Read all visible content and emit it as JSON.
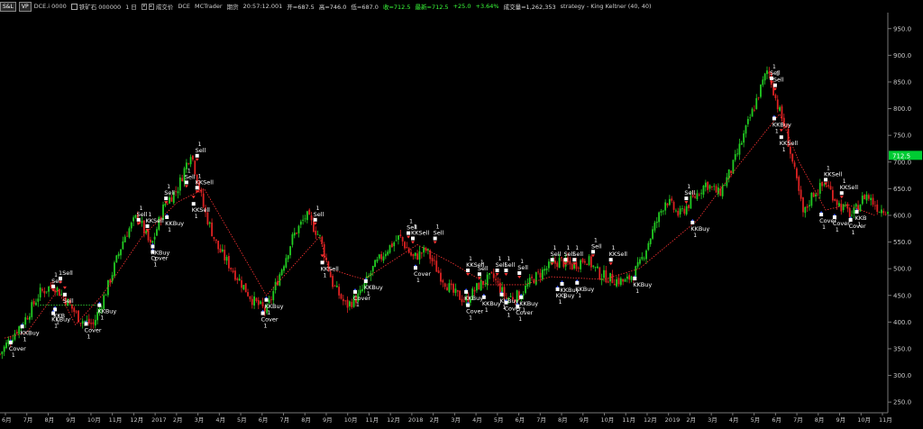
{
  "toolbar": {
    "btn1": "S&L",
    "btn2": "VP",
    "symbol_code": "DCE.i 0000",
    "symbol_name": "铁矿石 000000",
    "period": "1 日",
    "bar_type": "成交价",
    "exchange": "DCE",
    "source": "MCTrader",
    "note": "期货",
    "time": "20:57:12.001",
    "open": "开=687.5",
    "high": "高=746.0",
    "low": "低=687.0",
    "close": "收=712.5",
    "last": "最新=712.5",
    "change": "+25.0",
    "change_pct": "+3.64%",
    "volume": "成交量=1,262,353",
    "strategy": "strategy - King Keltner (40,  40)"
  },
  "colors": {
    "background": "#000000",
    "up_bar": "#22cc22",
    "down_bar": "#dd2222",
    "trade_line": "#ff3333",
    "breakeven_line": "#33cc33",
    "last_price_tag": "#00cc33",
    "axis_text": "#c8c8c8"
  },
  "chart_data": {
    "type": "candlestick",
    "y_axis": {
      "ylim": [
        230,
        980
      ],
      "ticks": [
        250,
        300,
        350,
        400,
        450,
        500,
        550,
        600,
        650,
        700,
        750,
        800,
        850,
        900,
        950
      ],
      "tick_labels": [
        "250.0",
        "300.0",
        "350.0",
        "400.0",
        "450.0",
        "500.0",
        "550.0",
        "600.0",
        "650.0",
        "700.0",
        "750.0",
        "800.0",
        "850.0",
        "900.0",
        "950.0"
      ],
      "last_price_label": "712.5",
      "last_price": 712.5
    },
    "x_axis": {
      "ticks": [
        "6月",
        "7月",
        "8月",
        "9月",
        "10月",
        "11月",
        "12月",
        "2017",
        "2月",
        "3月",
        "4月",
        "5月",
        "6月",
        "7月",
        "8月",
        "9月",
        "10月",
        "11月",
        "12月",
        "2018",
        "2月",
        "3月",
        "4月",
        "5月",
        "6月",
        "7月",
        "8月",
        "9月",
        "10月",
        "11月",
        "12月",
        "2019",
        "2月",
        "3月",
        "4月",
        "5月",
        "6月",
        "7月",
        "8月",
        "9月",
        "10月",
        "11月"
      ]
    },
    "price_path": [
      [
        0,
        340
      ],
      [
        0.012,
        370
      ],
      [
        0.03,
        410
      ],
      [
        0.045,
        455
      ],
      [
        0.06,
        470
      ],
      [
        0.075,
        440
      ],
      [
        0.09,
        405
      ],
      [
        0.105,
        395
      ],
      [
        0.12,
        460
      ],
      [
        0.14,
        560
      ],
      [
        0.155,
        600
      ],
      [
        0.17,
        540
      ],
      [
        0.185,
        620
      ],
      [
        0.2,
        650
      ],
      [
        0.215,
        720
      ],
      [
        0.23,
        610
      ],
      [
        0.245,
        540
      ],
      [
        0.265,
        490
      ],
      [
        0.285,
        440
      ],
      [
        0.3,
        420
      ],
      [
        0.315,
        490
      ],
      [
        0.33,
        560
      ],
      [
        0.345,
        600
      ],
      [
        0.36,
        560
      ],
      [
        0.375,
        470
      ],
      [
        0.39,
        430
      ],
      [
        0.405,
        450
      ],
      [
        0.42,
        500
      ],
      [
        0.435,
        535
      ],
      [
        0.45,
        560
      ],
      [
        0.465,
        520
      ],
      [
        0.48,
        535
      ],
      [
        0.495,
        490
      ],
      [
        0.51,
        455
      ],
      [
        0.525,
        440
      ],
      [
        0.54,
        470
      ],
      [
        0.555,
        485
      ],
      [
        0.57,
        445
      ],
      [
        0.585,
        450
      ],
      [
        0.6,
        480
      ],
      [
        0.615,
        500
      ],
      [
        0.63,
        515
      ],
      [
        0.645,
        505
      ],
      [
        0.66,
        520
      ],
      [
        0.675,
        490
      ],
      [
        0.69,
        480
      ],
      [
        0.705,
        475
      ],
      [
        0.72,
        505
      ],
      [
        0.735,
        570
      ],
      [
        0.75,
        630
      ],
      [
        0.765,
        600
      ],
      [
        0.78,
        630
      ],
      [
        0.795,
        660
      ],
      [
        0.81,
        640
      ],
      [
        0.825,
        690
      ],
      [
        0.84,
        760
      ],
      [
        0.855,
        830
      ],
      [
        0.865,
        875
      ],
      [
        0.875,
        810
      ],
      [
        0.885,
        760
      ],
      [
        0.895,
        680
      ],
      [
        0.905,
        600
      ],
      [
        0.915,
        640
      ],
      [
        0.93,
        660
      ],
      [
        0.945,
        620
      ],
      [
        0.96,
        600
      ],
      [
        0.975,
        640
      ],
      [
        0.99,
        612
      ]
    ],
    "trade_line_points": [
      [
        0.005,
        370
      ],
      [
        0.03,
        380
      ],
      [
        0.065,
        460
      ],
      [
        0.085,
        395
      ],
      [
        0.115,
        450
      ],
      [
        0.16,
        560
      ],
      [
        0.2,
        625
      ],
      [
        0.23,
        650
      ],
      [
        0.3,
        450
      ],
      [
        0.36,
        560
      ],
      [
        0.37,
        500
      ],
      [
        0.41,
        480
      ],
      [
        0.47,
        545
      ],
      [
        0.51,
        510
      ],
      [
        0.55,
        470
      ],
      [
        0.59,
        470
      ],
      [
        0.62,
        485
      ],
      [
        0.68,
        480
      ],
      [
        0.72,
        500
      ],
      [
        0.785,
        590
      ],
      [
        0.83,
        690
      ],
      [
        0.878,
        790
      ],
      [
        0.9,
        700
      ],
      [
        0.93,
        610
      ],
      [
        0.955,
        620
      ],
      [
        0.985,
        600
      ]
    ],
    "breakeven_segments": [
      [
        0.045,
        0.11,
        432
      ]
    ],
    "signals": [
      {
        "x": 0.012,
        "y": 370,
        "label": "Cover",
        "qty": "1",
        "pos": "below"
      },
      {
        "x": 0.025,
        "y": 400,
        "label": "KKBuy",
        "qty": "1",
        "pos": "below"
      },
      {
        "x": 0.06,
        "y": 455,
        "label": "Sell",
        "qty": "1",
        "pos": "above"
      },
      {
        "x": 0.068,
        "y": 470,
        "label": "1Sell",
        "qty": "",
        "pos": "above"
      },
      {
        "x": 0.073,
        "y": 460,
        "label": "Sell",
        "qty": "",
        "pos": "below"
      },
      {
        "x": 0.062,
        "y": 432,
        "label": "KKB",
        "qty": "1",
        "pos": "below"
      },
      {
        "x": 0.06,
        "y": 425,
        "label": "KKBuy",
        "qty": "1",
        "pos": "below"
      },
      {
        "x": 0.097,
        "y": 405,
        "label": "Cover",
        "qty": "1",
        "pos": "below"
      },
      {
        "x": 0.112,
        "y": 440,
        "label": "KKBuy",
        "qty": "1",
        "pos": "below"
      },
      {
        "x": 0.156,
        "y": 580,
        "label": "Sell",
        "qty": "1",
        "pos": "above"
      },
      {
        "x": 0.166,
        "y": 568,
        "label": "KKSell",
        "qty": "1",
        "pos": "above"
      },
      {
        "x": 0.172,
        "y": 550,
        "label": "KKBuy",
        "qty": "1",
        "pos": "below"
      },
      {
        "x": 0.172,
        "y": 540,
        "label": "Cover",
        "qty": "1",
        "pos": "below"
      },
      {
        "x": 0.188,
        "y": 605,
        "label": "KKBuy",
        "qty": "1",
        "pos": "below"
      },
      {
        "x": 0.187,
        "y": 620,
        "label": "Sell",
        "qty": "1",
        "pos": "above"
      },
      {
        "x": 0.21,
        "y": 650,
        "label": "Sell",
        "qty": "1",
        "pos": "above"
      },
      {
        "x": 0.222,
        "y": 700,
        "label": "Sell",
        "qty": "1",
        "pos": "above"
      },
      {
        "x": 0.222,
        "y": 640,
        "label": "KKSell",
        "qty": "1",
        "pos": "above"
      },
      {
        "x": 0.218,
        "y": 630,
        "label": "KKSell",
        "qty": "1",
        "pos": "below"
      },
      {
        "x": 0.3,
        "y": 450,
        "label": "KKBuy",
        "qty": "1",
        "pos": "below"
      },
      {
        "x": 0.296,
        "y": 425,
        "label": "Cover",
        "qty": "1",
        "pos": "below"
      },
      {
        "x": 0.355,
        "y": 580,
        "label": "Sell",
        "qty": "1",
        "pos": "above"
      },
      {
        "x": 0.363,
        "y": 520,
        "label": "KKSell",
        "qty": "1",
        "pos": "below"
      },
      {
        "x": 0.4,
        "y": 465,
        "label": "Cover",
        "qty": "1",
        "pos": "below"
      },
      {
        "x": 0.412,
        "y": 485,
        "label": "KKBuy",
        "qty": "1",
        "pos": "below"
      },
      {
        "x": 0.46,
        "y": 555,
        "label": "Sell",
        "qty": "1",
        "pos": "above"
      },
      {
        "x": 0.465,
        "y": 545,
        "label": "KKSell",
        "qty": "1",
        "pos": "above"
      },
      {
        "x": 0.49,
        "y": 545,
        "label": "Sell",
        "qty": "1",
        "pos": "above"
      },
      {
        "x": 0.468,
        "y": 510,
        "label": "Cover",
        "qty": "1",
        "pos": "below"
      },
      {
        "x": 0.527,
        "y": 485,
        "label": "KKSell",
        "qty": "1",
        "pos": "above"
      },
      {
        "x": 0.525,
        "y": 465,
        "label": "KKBuy",
        "qty": "1",
        "pos": "below"
      },
      {
        "x": 0.527,
        "y": 440,
        "label": "Cover",
        "qty": "1",
        "pos": "below"
      },
      {
        "x": 0.54,
        "y": 478,
        "label": "Sell",
        "qty": "1",
        "pos": "above"
      },
      {
        "x": 0.545,
        "y": 455,
        "label": "KKBuy",
        "qty": "1",
        "pos": "below"
      },
      {
        "x": 0.56,
        "y": 485,
        "label": "Sell",
        "qty": "1",
        "pos": "above"
      },
      {
        "x": 0.57,
        "y": 485,
        "label": "Sell",
        "qty": "1",
        "pos": "above"
      },
      {
        "x": 0.585,
        "y": 480,
        "label": "Sell",
        "qty": "1",
        "pos": "above"
      },
      {
        "x": 0.565,
        "y": 460,
        "label": "KKBuy",
        "qty": "1",
        "pos": "below"
      },
      {
        "x": 0.57,
        "y": 445,
        "label": "Cover",
        "qty": "1",
        "pos": "below"
      },
      {
        "x": 0.587,
        "y": 455,
        "label": "KKBuy",
        "qty": "1",
        "pos": "below"
      },
      {
        "x": 0.583,
        "y": 438,
        "label": "Cover",
        "qty": "1",
        "pos": "below"
      },
      {
        "x": 0.622,
        "y": 505,
        "label": "Sell",
        "qty": "1",
        "pos": "above"
      },
      {
        "x": 0.637,
        "y": 505,
        "label": "Sell",
        "qty": "1",
        "pos": "above"
      },
      {
        "x": 0.647,
        "y": 505,
        "label": "Sell",
        "qty": "1",
        "pos": "above"
      },
      {
        "x": 0.633,
        "y": 480,
        "label": "KKBuy",
        "qty": "1",
        "pos": "below"
      },
      {
        "x": 0.628,
        "y": 470,
        "label": "KKBuy",
        "qty": "1",
        "pos": "below"
      },
      {
        "x": 0.65,
        "y": 482,
        "label": "KKBuy",
        "qty": "1",
        "pos": "below"
      },
      {
        "x": 0.668,
        "y": 520,
        "label": "Sell",
        "qty": "1",
        "pos": "above"
      },
      {
        "x": 0.688,
        "y": 505,
        "label": "KKSell",
        "qty": "1",
        "pos": "above"
      },
      {
        "x": 0.715,
        "y": 490,
        "label": "KKBuy",
        "qty": "1",
        "pos": "below"
      },
      {
        "x": 0.773,
        "y": 620,
        "label": "Sell",
        "qty": "1",
        "pos": "above"
      },
      {
        "x": 0.78,
        "y": 595,
        "label": "KKBuy",
        "qty": "1",
        "pos": "below"
      },
      {
        "x": 0.869,
        "y": 845,
        "label": "Sell",
        "qty": "1",
        "pos": "above"
      },
      {
        "x": 0.873,
        "y": 832,
        "label": "Sell",
        "qty": "1",
        "pos": "above"
      },
      {
        "x": 0.872,
        "y": 790,
        "label": "KKBuy",
        "qty": "1",
        "pos": "below"
      },
      {
        "x": 0.88,
        "y": 755,
        "label": "KKSell",
        "qty": "1",
        "pos": "below"
      },
      {
        "x": 0.93,
        "y": 655,
        "label": "KKSell",
        "qty": "1",
        "pos": "above"
      },
      {
        "x": 0.925,
        "y": 610,
        "label": "Cover",
        "qty": "1",
        "pos": "below"
      },
      {
        "x": 0.948,
        "y": 630,
        "label": "KKSell",
        "qty": "1",
        "pos": "above"
      },
      {
        "x": 0.94,
        "y": 605,
        "label": "Cover",
        "qty": "1",
        "pos": "below"
      },
      {
        "x": 0.958,
        "y": 600,
        "label": "Cover",
        "qty": "1",
        "pos": "below"
      },
      {
        "x": 0.965,
        "y": 615,
        "label": "KKB",
        "qty": "1",
        "pos": "below"
      }
    ]
  }
}
